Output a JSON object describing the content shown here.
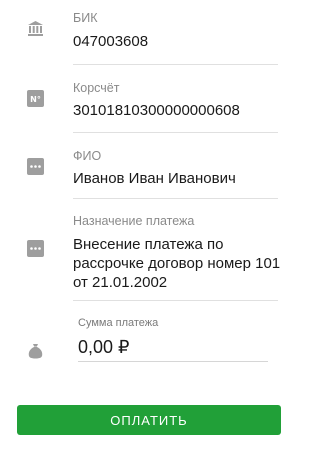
{
  "fields": {
    "bik": {
      "label": "БИК",
      "value": "047003608",
      "icon": "bank-icon"
    },
    "korschet": {
      "label": "Корсчёт",
      "value": "30101810300000000608",
      "icon": "number-sign-icon"
    },
    "fio": {
      "label": "ФИО",
      "value": "Иванов Иван Иванович",
      "icon": "more-icon"
    },
    "purpose": {
      "label": "Назначение платежа",
      "value": "Внесение платежа по рассрочке договор номер 101 от 21.01.2002",
      "icon": "more-icon"
    }
  },
  "amount": {
    "label": "Сумма платежа",
    "value": "0,00 ₽",
    "icon": "money-bag-icon"
  },
  "pay_button": {
    "label": "ОПЛАТИТЬ"
  },
  "colors": {
    "accent": "#21a038",
    "icon": "#9e9e9e",
    "label": "#8a8a8a"
  }
}
